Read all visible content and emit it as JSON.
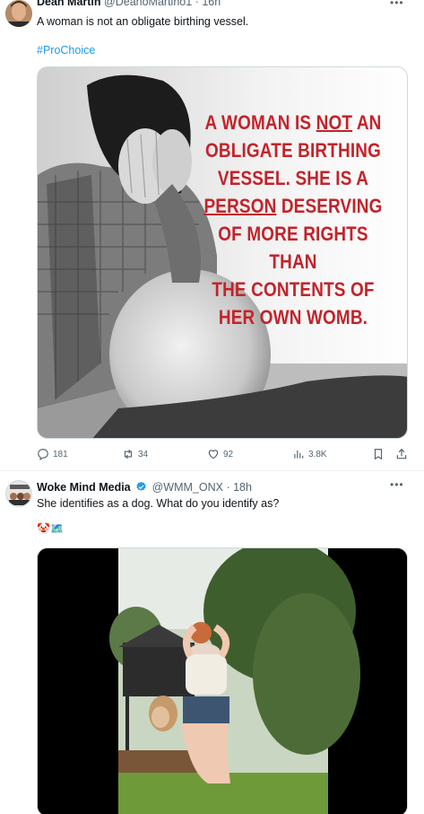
{
  "tweets": [
    {
      "author_name": "Dean Martin",
      "handle": "@DeanoMartino1",
      "separator": "·",
      "time": "16h",
      "text": "A woman is not an obligate birthing vessel.",
      "hashtag": "#ProChoice",
      "poster_lines": [
        "A WOMAN IS ",
        "NOT",
        " AN",
        "OBLIGATE BIRTHING",
        "VESSEL. SHE IS A",
        "PERSON",
        " DESERVING",
        "OF MORE RIGHTS THAN",
        "THE CONTENTS OF",
        "HER OWN WOMB."
      ],
      "stats": {
        "replies": "181",
        "retweets": "34",
        "likes": "92",
        "views": "3.8K"
      },
      "more_icon": "more-horizontal-icon"
    },
    {
      "author_name": "Woke Mind Media",
      "handle": "@WMM_ONX",
      "separator": "·",
      "time": "18h",
      "text": "She identifies as a dog. What do you identify as?",
      "emoji": "🤡🗺️",
      "verified": true,
      "more_icon": "more-horizontal-icon"
    }
  ],
  "colors": {
    "accent": "#1d9bf0",
    "poster_red": "#c3232a",
    "secondary_text": "#536471"
  }
}
